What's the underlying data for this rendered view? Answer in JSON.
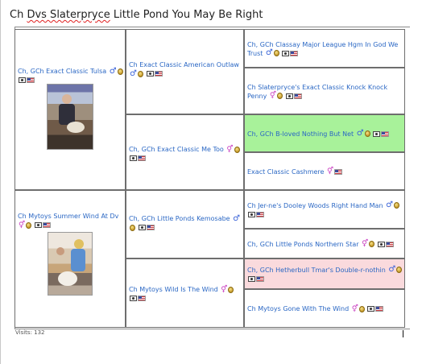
{
  "page": {
    "title_prefix": "Ch ",
    "title_underlined": "Dvs Slaterpryce",
    "title_suffix": " Little Pond You May Be Right"
  },
  "pedigree": {
    "sire": {
      "name": "Ch, GCh Exact Classic Tulsa",
      "sex": "male"
    },
    "dam": {
      "name": "Ch Mytoys Summer Wind At Dv",
      "sex": "female"
    },
    "sire_sire": {
      "name": "Ch Exact Classic American Outlaw",
      "sex": "male"
    },
    "sire_dam": {
      "name": "Ch, GCh Exact Classic Me Too",
      "sex": "female"
    },
    "dam_sire": {
      "name": "Ch, GCh Little Ponds Kemosabe",
      "sex": "male"
    },
    "dam_dam": {
      "name": "Ch Mytoys Wild Is The Wind",
      "sex": "female"
    },
    "ggp": [
      {
        "name": "Ch, GCh Classay Major League Hgm In God We Trust",
        "sex": "male"
      },
      {
        "name": "Ch Slaterpryce's Exact Classic Knock Knock Penny",
        "sex": "female"
      },
      {
        "name": "Ch, GCh B-loved Nothing But Net",
        "sex": "male"
      },
      {
        "name": "Exact Classic Cashmere",
        "sex": "female"
      },
      {
        "name": "Ch Jer-ne's Dooley Woods Right Hand Man",
        "sex": "male"
      },
      {
        "name": "Ch, GCh Little Ponds Northern Star",
        "sex": "female"
      },
      {
        "name": "Ch, GCh Hetherbull Tmar's Double-r-nothin",
        "sex": "male"
      },
      {
        "name": "Ch Mytoys Gone With The Wind",
        "sex": "female"
      }
    ]
  },
  "symbols": {
    "male": "♂",
    "female": "⚥"
  },
  "colors": {
    "link": "#2a67c4",
    "highlight_green": "#a8f29a",
    "highlight_pink": "#fadadd"
  },
  "footer": {
    "visits": "Visits: 132"
  }
}
